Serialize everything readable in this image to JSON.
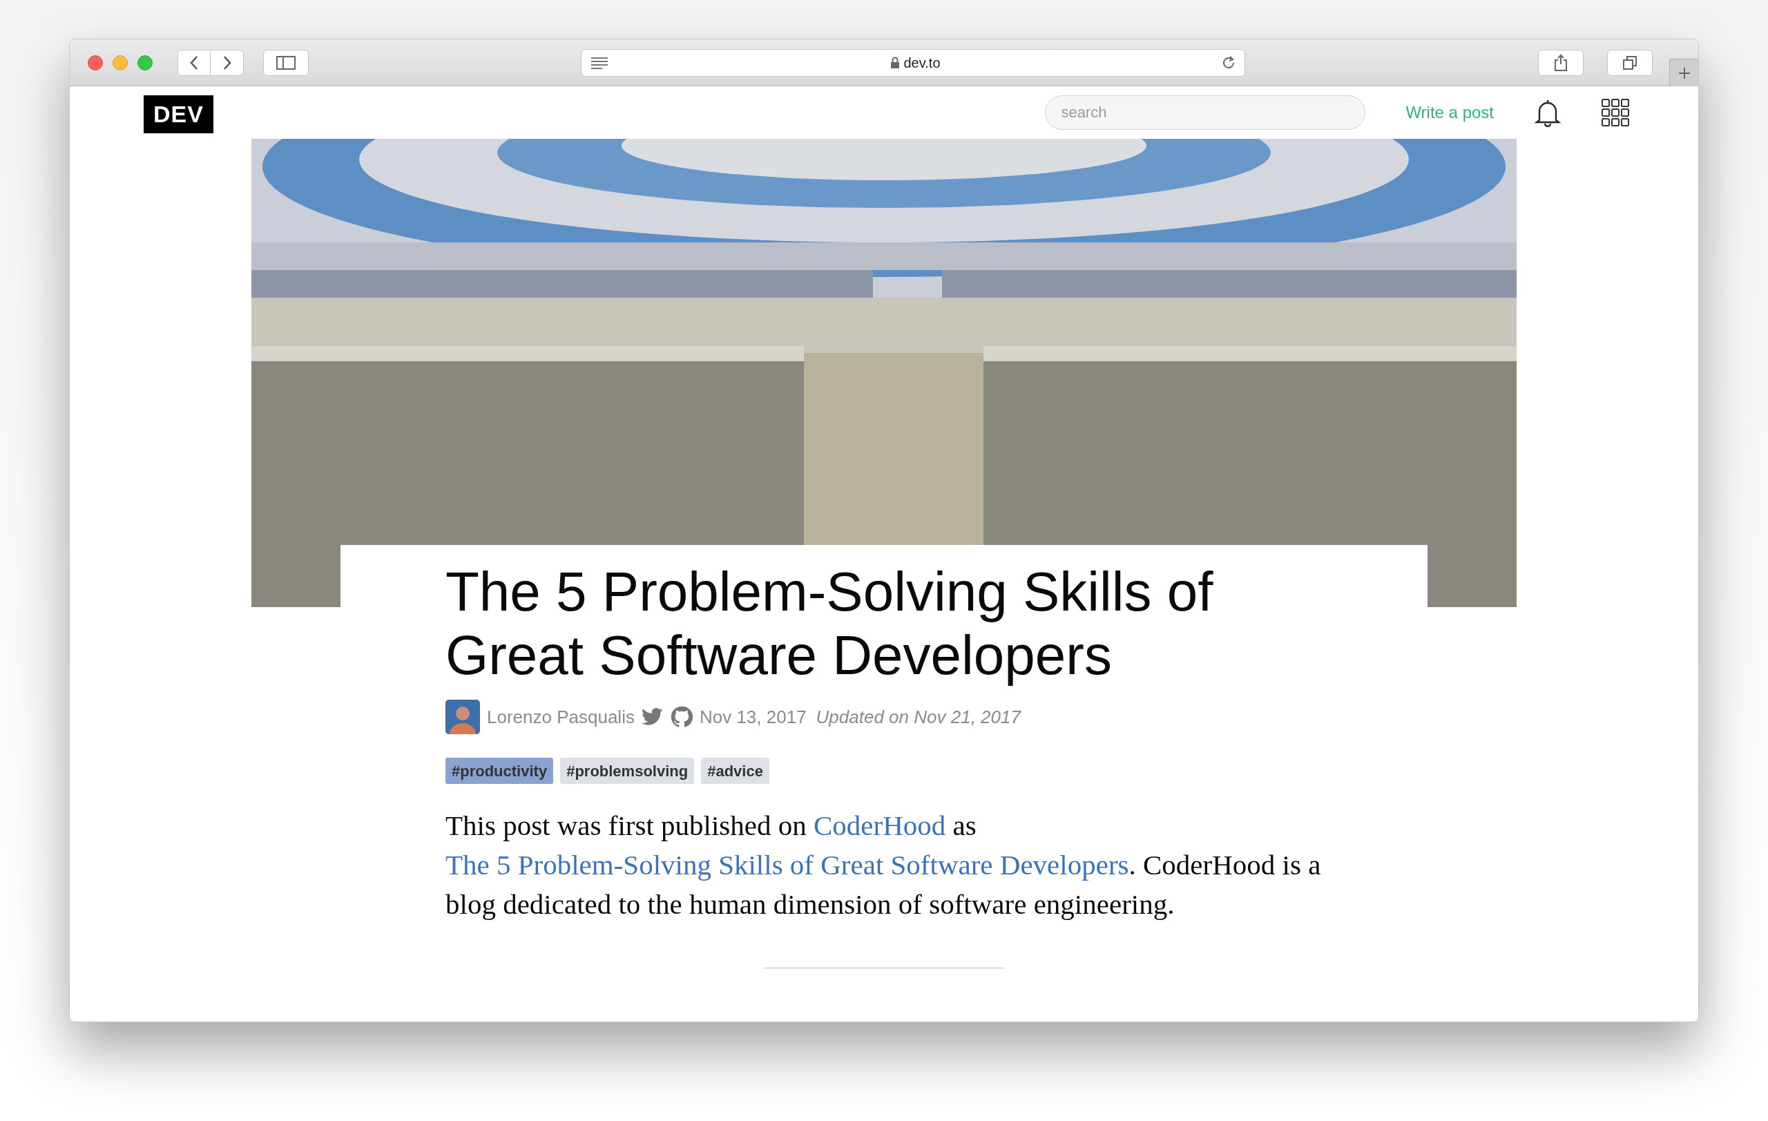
{
  "browser": {
    "address": "dev.to"
  },
  "header": {
    "logo": "DEV",
    "search": {
      "placeholder": "search"
    },
    "write_link": "Write a post"
  },
  "article": {
    "title": "The 5 Problem-Solving Skills of Great Software Developers",
    "author": "Lorenzo Pasqualis",
    "date": "Nov 13, 2017",
    "updated": "Updated on Nov 21, 2017",
    "tags": [
      {
        "label": "#productivity",
        "color": "#8aa2cf"
      },
      {
        "label": "#problemsolving",
        "color": "#dde1e7"
      },
      {
        "label": "#advice",
        "color": "#dde1e7"
      }
    ],
    "intro": [
      {
        "text": "This post was first published on ",
        "link": false
      },
      {
        "text": "CoderHood",
        "link": true
      },
      {
        "text": " as ",
        "link": false
      },
      {
        "text": "The 5 Problem-Solving Skills of Great Software Developers",
        "link": true
      },
      {
        "text": ". CoderHood is a blog dedicated to the human dimension of software engineering.",
        "link": false
      }
    ]
  }
}
